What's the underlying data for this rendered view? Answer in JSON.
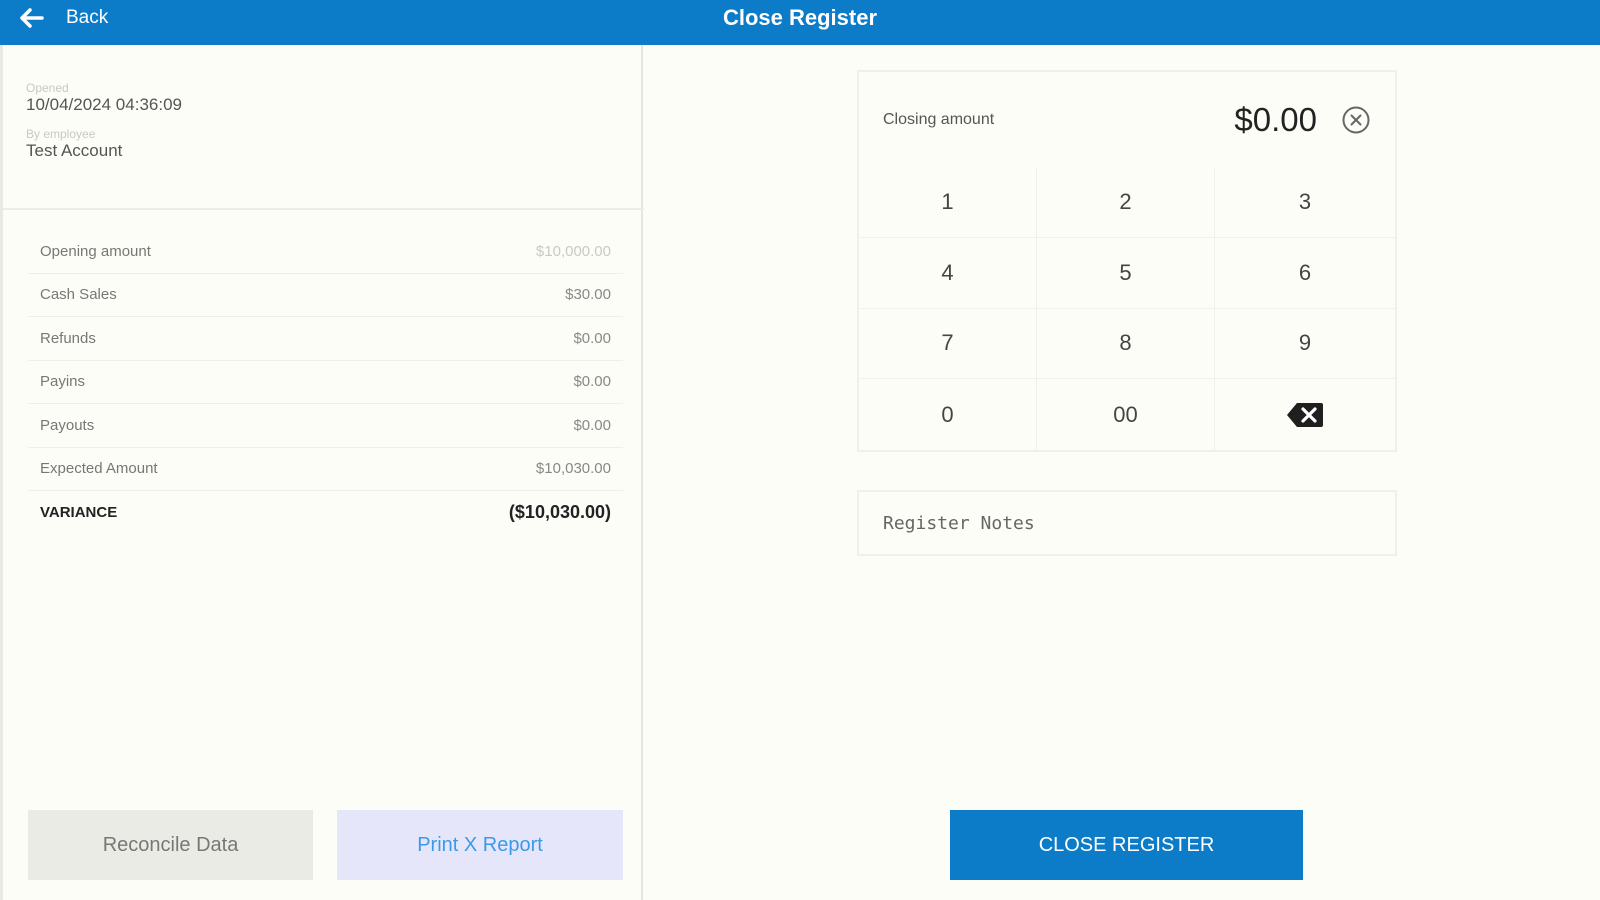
{
  "header": {
    "back_label": "Back",
    "title": "Close Register",
    "bar_color": "#0c7cc9"
  },
  "meta": {
    "opened_label": "Opened",
    "opened_value": "10/04/2024 04:36:09",
    "employee_label": "By employee",
    "employee_value": "Test Account"
  },
  "summary": [
    {
      "name": "Opening amount",
      "amount": "$10,000.00"
    },
    {
      "name": "Cash Sales",
      "amount": "$30.00"
    },
    {
      "name": "Refunds",
      "amount": "$0.00"
    },
    {
      "name": "Payins",
      "amount": "$0.00"
    },
    {
      "name": "Payouts",
      "amount": "$0.00"
    },
    {
      "name": "Expected Amount",
      "amount": "$10,030.00"
    },
    {
      "name": "VARIANCE",
      "amount": "($10,030.00)"
    }
  ],
  "buttons": {
    "reconcile": "Reconcile Data",
    "print": "Print X Report",
    "close": "CLOSE REGISTER"
  },
  "keypad": {
    "closing_label": "Closing amount",
    "closing_value": "$0.00",
    "keys": [
      "1",
      "2",
      "3",
      "4",
      "5",
      "6",
      "7",
      "8",
      "9",
      "0",
      "00"
    ],
    "backspace_icon": "backspace-icon",
    "clear_icon": "clear-circle-icon"
  },
  "notes": {
    "placeholder": "Register Notes"
  }
}
